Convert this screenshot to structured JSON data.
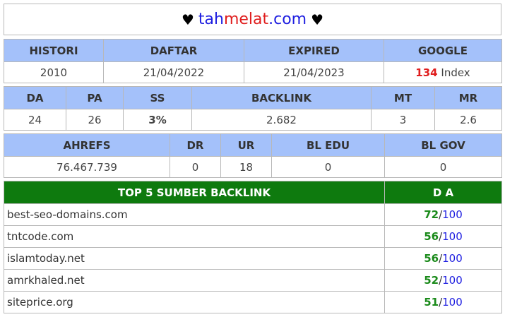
{
  "title": {
    "heart": "♥",
    "domain_part1": "tah",
    "domain_part2": "melat",
    "domain_part3": ".com"
  },
  "colors": {
    "header_bg": "#a4c1fa",
    "top5_header_bg": "#0e7a0e",
    "accent_red": "#e01e1e",
    "accent_green": "#1a8a1a",
    "accent_blue": "#1e1ee0"
  },
  "row1": {
    "headers": [
      "HISTORI",
      "DAFTAR",
      "EXPIRED",
      "GOOGLE"
    ],
    "histori": "2010",
    "daftar": "21/04/2022",
    "expired": "21/04/2023",
    "google_count": "134",
    "google_suffix": "Index"
  },
  "row2": {
    "headers": [
      "DA",
      "PA",
      "SS",
      "BACKLINK",
      "MT",
      "MR"
    ],
    "values": [
      "24",
      "26",
      "3%",
      "2.682",
      "3",
      "2.6"
    ]
  },
  "row3": {
    "headers": [
      "AHREFS",
      "DR",
      "UR",
      "BL EDU",
      "BL GOV"
    ],
    "values": [
      "76.467.739",
      "0",
      "18",
      "0",
      "0"
    ]
  },
  "top5": {
    "header_source": "TOP 5 SUMBER BACKLINK",
    "header_da": "D A",
    "separator": "/",
    "rows": [
      {
        "domain": "best-seo-domains.com",
        "da": "72",
        "max": "100"
      },
      {
        "domain": "tntcode.com",
        "da": "56",
        "max": "100"
      },
      {
        "domain": "islamtoday.net",
        "da": "56",
        "max": "100"
      },
      {
        "domain": "amrkhaled.net",
        "da": "52",
        "max": "100"
      },
      {
        "domain": "siteprice.org",
        "da": "51",
        "max": "100"
      }
    ]
  }
}
